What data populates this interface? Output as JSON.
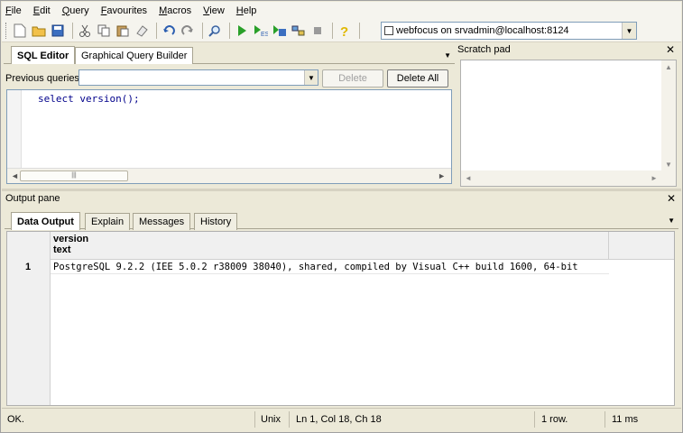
{
  "menubar": {
    "items": [
      "File",
      "Edit",
      "Query",
      "Favourites",
      "Macros",
      "View",
      "Help"
    ]
  },
  "toolbar": {
    "buttons": [
      "new-icon",
      "open-icon",
      "save-icon",
      "cut-icon",
      "copy-icon",
      "paste-icon",
      "clear-icon",
      "undo-icon",
      "redo-icon",
      "find-icon",
      "execute-icon",
      "explain-icon",
      "execute-to-file-icon",
      "query-builder-icon",
      "stop-icon",
      "help-icon"
    ],
    "connection_label": "webfocus on srvadmin@localhost:8124"
  },
  "sql_panel": {
    "tabs": [
      "SQL Editor",
      "Graphical Query Builder"
    ],
    "previous_queries_label": "Previous queries",
    "previous_queries_value": "",
    "delete_label": "Delete",
    "delete_all_label": "Delete All",
    "query_text": "select version();"
  },
  "scratch_pad": {
    "title": "Scratch pad"
  },
  "output_pane": {
    "title": "Output pane",
    "tabs": [
      "Data Output",
      "Explain",
      "Messages",
      "History"
    ],
    "column": {
      "name": "version",
      "type": "text"
    },
    "rows": [
      {
        "num": "1",
        "value": "PostgreSQL 9.2.2 (IEE 5.0.2 r38009 38040), shared, compiled by Visual C++ build 1600, 64-bit"
      }
    ]
  },
  "status_bar": {
    "state": "OK.",
    "line_ending": "Unix",
    "position": "Ln 1, Col 18, Ch 18",
    "row_count": "1 row.",
    "duration": "11 ms"
  }
}
